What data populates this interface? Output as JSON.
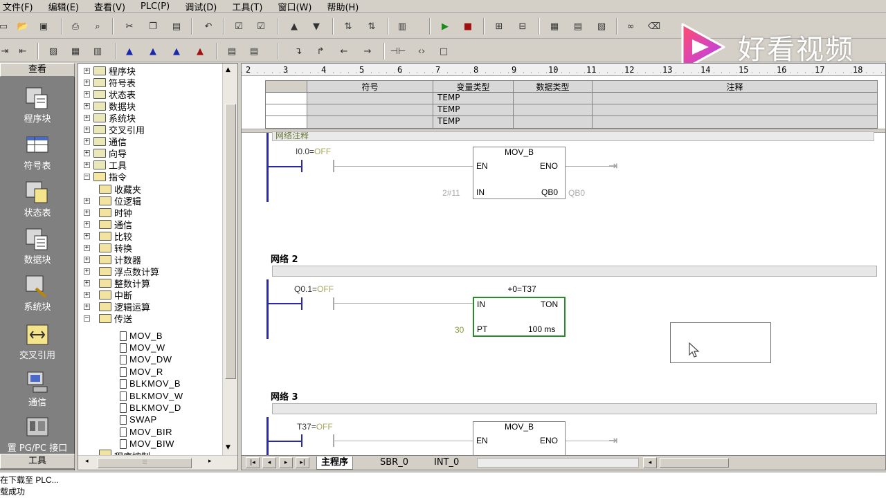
{
  "menu": [
    "文件(F)",
    "编辑(E)",
    "查看(V)",
    "PLC(P)",
    "调试(D)",
    "工具(T)",
    "窗口(W)",
    "帮助(H)"
  ],
  "watermark": {
    "text": "好看视频",
    "logo_colors": [
      "#ff4f6b",
      "#b43cff"
    ]
  },
  "navbar": {
    "header": "查看",
    "footer": "工具",
    "items": [
      {
        "label": "程序块",
        "icon": "program-block-icon"
      },
      {
        "label": "符号表",
        "icon": "symbol-table-icon"
      },
      {
        "label": "状态表",
        "icon": "status-table-icon"
      },
      {
        "label": "数据块",
        "icon": "data-block-icon"
      },
      {
        "label": "系统块",
        "icon": "system-block-icon"
      },
      {
        "label": "交叉引用",
        "icon": "cross-reference-icon"
      },
      {
        "label": "通信",
        "icon": "communication-icon"
      },
      {
        "label": "置 PG/PC 接口",
        "icon": "pg-pc-interface-icon"
      }
    ]
  },
  "tree": {
    "top_items": [
      "程序块",
      "符号表",
      "状态表",
      "数据块",
      "系统块",
      "交叉引用",
      "通信",
      "向导",
      "工具"
    ],
    "instructions_label": "指令",
    "instruction_groups": [
      "收藏夹",
      "位逻辑",
      "时钟",
      "通信",
      "比较",
      "转换",
      "计数器",
      "浮点数计算",
      "整数计算",
      "中断",
      "逻辑运算",
      "传送"
    ],
    "transfer_instructions": [
      "MOV_B",
      "MOV_W",
      "MOV_DW",
      "MOV_R",
      "BLKMOV_B",
      "BLKMOV_W",
      "BLKMOV_D",
      "SWAP",
      "MOV_BIR",
      "MOV_BIW"
    ],
    "last_item_partial": "程序控制"
  },
  "ruler": [
    "2",
    "3",
    "4",
    "5",
    "6",
    "7",
    "8",
    "9",
    "10",
    "11",
    "12",
    "13",
    "14",
    "15",
    "16",
    "17",
    "18"
  ],
  "var_table": {
    "headers": [
      "符号",
      "变量类型",
      "数据类型",
      "注释"
    ],
    "rows": [
      "TEMP",
      "TEMP",
      "TEMP"
    ]
  },
  "networks": [
    {
      "title": "网络注释",
      "contact": "I0.0",
      "contact_state": "OFF",
      "box_name": "MOV_B",
      "pin_en": "EN",
      "pin_eno": "ENO",
      "pin_in": "IN",
      "pin_out": "QB0",
      "in_value": "2#11",
      "out_value": "QB0"
    },
    {
      "title": "网络 2",
      "contact": "Q0.1",
      "contact_state": "OFF",
      "box_label": "+0=T37",
      "pin_in": "IN",
      "pin_ton": "TON",
      "pin_pt": "PT",
      "pt_value": "30",
      "time_base": "100 ms"
    },
    {
      "title": "网络 3",
      "contact": "T37",
      "contact_state": "OFF",
      "box_name": "MOV_B",
      "pin_en": "EN",
      "pin_eno": "ENO"
    }
  ],
  "tabs": [
    "主程序",
    "SBR_0",
    "INT_0"
  ],
  "status": [
    "正在下载至 PLC...",
    "下载成功"
  ]
}
